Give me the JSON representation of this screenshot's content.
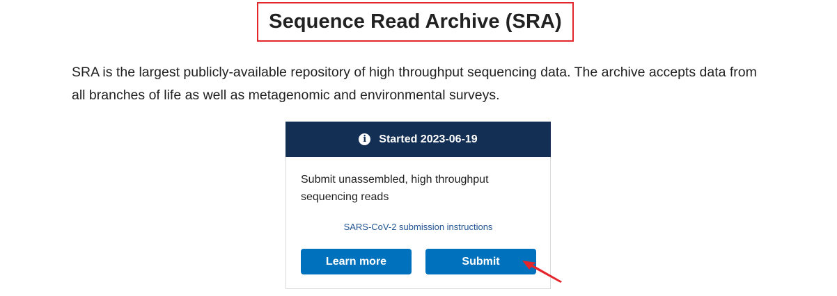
{
  "header": {
    "title": "Sequence Read Archive (SRA)"
  },
  "intro": {
    "text": "SRA is the largest publicly-available repository of high throughput sequencing data. The archive accepts data from all branches of life as well as metagenomic and environmental surveys."
  },
  "card": {
    "status_label": "Started 2023-06-19",
    "status_icon": "info-circle-icon",
    "description": "Submit unassembled, high throughput sequencing reads",
    "link_text": "SARS-CoV-2 submission instructions",
    "learn_more_label": "Learn more",
    "submit_label": "Submit"
  },
  "colors": {
    "header_bg": "#132f54",
    "button_bg": "#0071bc",
    "link": "#205493",
    "highlight": "#e3262b"
  }
}
